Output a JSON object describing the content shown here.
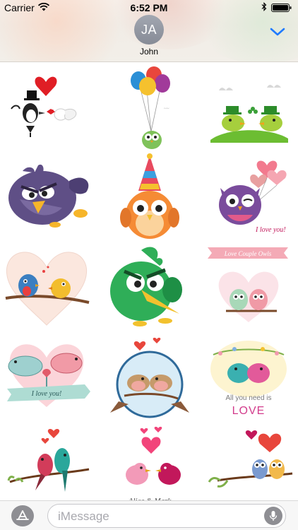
{
  "status_bar": {
    "carrier": "Carrier",
    "time": "6:52 PM"
  },
  "header": {
    "avatar_initials": "JA",
    "contact_name": "John",
    "accent_color": "#1f7aff"
  },
  "stickers": {
    "love_owls_banner": "Love Couple Owls",
    "i_love_you_owl": "I love you!",
    "i_love_you_birds": "I love you!",
    "all_you_need_line1": "All you need is",
    "all_you_need_line2": "LOVE",
    "alice_mark": "Alice & Mark"
  },
  "compose": {
    "placeholder": "iMessage"
  }
}
